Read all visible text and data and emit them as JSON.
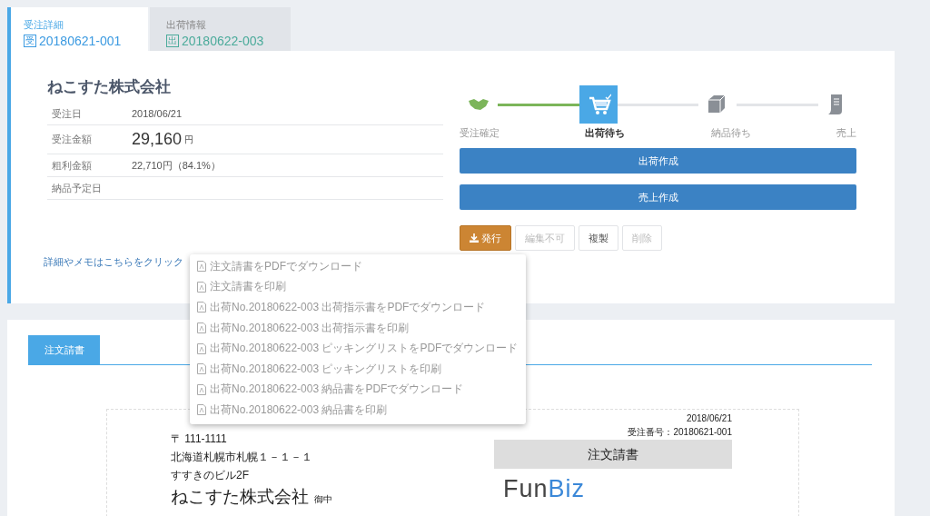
{
  "top_tabs": [
    {
      "label": "受注詳細",
      "badge": "受",
      "number": "20180621-001",
      "selected": true
    },
    {
      "label": "出荷情報",
      "badge": "出",
      "number": "20180622-003",
      "selected": false
    }
  ],
  "company": "ねこすた株式会社",
  "details": [
    {
      "kind": "plain",
      "label": "受注日",
      "value": "2018/06/21"
    },
    {
      "kind": "amount",
      "label": "受注金額",
      "value": "29,160",
      "unit": "円"
    },
    {
      "kind": "plain",
      "label": "粗利金額",
      "value": "22,710円（84.1%）"
    },
    {
      "kind": "plain",
      "label": "納品予定日"
    }
  ],
  "memo_link": "詳細やメモはこちらをクリック",
  "steps": [
    {
      "kind": "handshake",
      "label": "受注確定",
      "current": false
    },
    {
      "kind": "cart",
      "label": "出荷待ち",
      "current": true
    },
    {
      "kind": "box",
      "label": "納品待ち",
      "current": false
    },
    {
      "kind": "receipt",
      "label": "売上",
      "current": false
    }
  ],
  "primary_buttons": [
    "出荷作成",
    "売上作成"
  ],
  "actions": [
    {
      "kind": "issue",
      "label": "発行",
      "disabled": false
    },
    {
      "kind": "plain",
      "label": "編集不可",
      "disabled": true
    },
    {
      "kind": "plain",
      "label": "複製",
      "disabled": false
    },
    {
      "kind": "plain",
      "label": "削除",
      "disabled": true
    }
  ],
  "issue_menu": [
    "注文請書をPDFでダウンロード",
    "注文請書を印刷",
    "出荷No.20180622-003 出荷指示書をPDFでダウンロード",
    "出荷No.20180622-003 出荷指示書を印刷",
    "出荷No.20180622-003 ピッキングリストをPDFでダウンロード",
    "出荷No.20180622-003 ピッキングリストを印刷",
    "出荷No.20180622-003 納品書をPDFでダウンロード",
    "出荷No.20180622-003 納品書を印刷"
  ],
  "doc_tabs": [
    {
      "label": "注文請書",
      "selected": true
    }
  ],
  "document": {
    "postal": "〒 111-1111",
    "address_1": "北海道札幌市札幌１－１－１",
    "address_2": "すすきのビル2F",
    "recipient": "ねこすた株式会社",
    "honorific": "御中",
    "date": "2018/06/21",
    "order_no": "受注番号：20180621-001",
    "title": "注文請書",
    "logo": [
      "Fun",
      "Biz"
    ]
  }
}
